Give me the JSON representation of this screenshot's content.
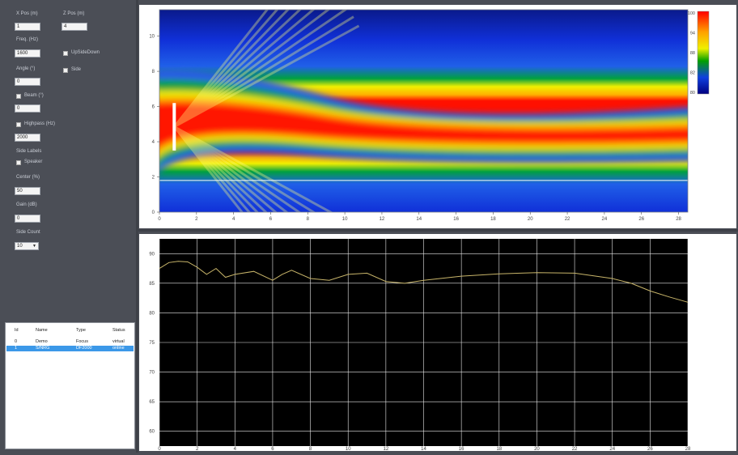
{
  "controls": {
    "x_pos_label": "X Pos (m)",
    "x_pos_value": "1",
    "z_pos_label": "Z Pos (m)",
    "z_pos_value": "4",
    "freq_label": "Freq. (Hz)",
    "freq_value": "1600",
    "upsidedown_label": "UpSideDown",
    "side_label": "Side",
    "angle_label": "Angle (°)",
    "angle_value": "0",
    "beam_label": "Beam (°)",
    "beam_value": "0",
    "highpass_label": "Highpass (Hz)",
    "highpass_value": "2000",
    "side_labels_label": "Side Labels",
    "speaker_label": "Speaker",
    "center_label": "Center (%)",
    "center_value": "50",
    "gain_label": "Gain (dB)",
    "gain_value": "0",
    "side_count_label": "Side Count",
    "side_count_value": "10"
  },
  "source_list": {
    "headers": [
      "Id",
      "Name",
      "Type",
      "Status"
    ],
    "rows": [
      {
        "id": "0",
        "name": "Demo",
        "type": "Focus",
        "status": "virtual"
      },
      {
        "id": "1",
        "name": "S/NRG",
        "type": "DF2000",
        "status": "online"
      }
    ],
    "selected_index": 1
  },
  "colors": {
    "panel_bg": "#4b4e56",
    "window_bg": "#4a4d55",
    "selection": "#3b98e8",
    "trace": "#c8b56a",
    "grid": "#e8e8e8",
    "hot": "#ff0000",
    "cold": "#0018c8"
  },
  "heatmap": {
    "x_ticks": [
      "0",
      "2",
      "4",
      "6",
      "8",
      "10",
      "12",
      "14",
      "16",
      "18",
      "20",
      "22",
      "24",
      "26",
      "28"
    ],
    "y_ticks": [
      "0",
      "2",
      "4",
      "6",
      "8",
      "10"
    ],
    "colorbar_ticks": [
      "100",
      "94",
      "88",
      "82",
      "80"
    ],
    "x_range": [
      0,
      28.5
    ],
    "y_range": [
      0,
      11.5
    ],
    "slice_line_y": 1.8,
    "source_x": 0.8,
    "source_y_range": [
      3.5,
      6.2
    ]
  },
  "chart_data": {
    "type": "line",
    "x_ticks": [
      "0",
      "2",
      "4",
      "6",
      "8",
      "10",
      "12",
      "14",
      "16",
      "18",
      "20",
      "22",
      "24",
      "26",
      "28"
    ],
    "y_ticks": [
      "90",
      "85",
      "80",
      "75",
      "70",
      "65",
      "60"
    ],
    "xlim": [
      0,
      28
    ],
    "ylim": [
      57.5,
      92.5
    ],
    "grid": true,
    "x": [
      0,
      0.5,
      1,
      1.5,
      2,
      2.5,
      3,
      3.5,
      4,
      5,
      6,
      6.5,
      7,
      8,
      9,
      10,
      11,
      12,
      13,
      14,
      16,
      18,
      20,
      22,
      24,
      25,
      26,
      27,
      28
    ],
    "y": [
      87.5,
      88.5,
      88.7,
      88.6,
      87.7,
      86.5,
      87.5,
      86.0,
      86.5,
      87.0,
      85.5,
      86.5,
      87.2,
      85.8,
      85.5,
      86.5,
      86.7,
      85.3,
      85.0,
      85.5,
      86.2,
      86.6,
      86.8,
      86.7,
      85.8,
      85.0,
      83.7,
      82.7,
      81.8
    ]
  }
}
